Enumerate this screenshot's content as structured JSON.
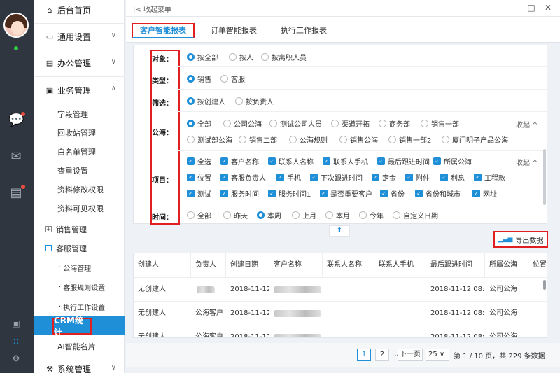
{
  "nav": {
    "home": "后台首页",
    "general": "通用设置",
    "office": "办公管理",
    "business": "业务管理",
    "business_items": [
      "字段管理",
      "回收站管理",
      "白名单管理",
      "查重设置",
      "资料修改权限",
      "资料可见权限"
    ],
    "sales": "销售管理",
    "service": "客服管理",
    "service_items": [
      "公海管理",
      "客服规则设置",
      "执行工作设置"
    ],
    "crm": "CRM统计",
    "ai": "AI智能名片",
    "system": "系统管理"
  },
  "window": {
    "collapse_label": "收起菜单"
  },
  "tabs": [
    "客户智能报表",
    "订单智能报表",
    "执行工作报表"
  ],
  "filters": {
    "object_label": "对象：",
    "object_options": [
      "按全部",
      "按人",
      "按离职人员"
    ],
    "type_label": "类型：",
    "type_options": [
      "销售",
      "客服"
    ],
    "filter_label": "筛选：",
    "filter_options": [
      "按创建人",
      "按负责人"
    ],
    "sea_label": "公海：",
    "sea_row1": [
      "全部",
      "公司公海",
      "测试公司人员",
      "渠道开拓",
      "商务部",
      "销售一部"
    ],
    "sea_row2": [
      "测试部公海",
      "销售二部",
      "公海规则",
      "销售公海",
      "销售一部2",
      "厦门明子产品公海"
    ],
    "collapse": "收起 ^",
    "project_label": "项目：",
    "project_row1": [
      "全选",
      "客户名称",
      "联系人名称",
      "联系人手机",
      "最后跟进时间",
      "所属公海"
    ],
    "project_row2": [
      "位置",
      "客服负责人",
      "手机",
      "下次跟进时间",
      "定金",
      "附件",
      "利息",
      "工程款"
    ],
    "project_row3": [
      "测试",
      "服务时间",
      "服务时间1",
      "是否重要客户",
      "省份",
      "省份和城市",
      "网址"
    ],
    "time_label": "时间：",
    "time_options": [
      "全部",
      "昨天",
      "本周",
      "上月",
      "本月",
      "今年",
      "自定义日期"
    ]
  },
  "export_label": "导出数据",
  "table": {
    "headers": [
      "创建人",
      "负责人",
      "创建日期",
      "客户名称",
      "联系人名称",
      "联系人手机",
      "最后跟进时间",
      "所属公海",
      "位置"
    ],
    "rows": [
      {
        "creator": "无创建人",
        "owner": "",
        "date": "2018-11-12",
        "last": "2018-11-12 08:4!",
        "sea": "公司公海"
      },
      {
        "creator": "无创建人",
        "owner": "公海客户",
        "date": "2018-11-12",
        "last": "2018-11-12 08:5:",
        "sea": "公司公海"
      },
      {
        "creator": "无创建人",
        "owner": "公海客户",
        "date": "2018-11-12",
        "last": "2018-11-12 08:5:",
        "sea": "公司公海"
      }
    ]
  },
  "pager": {
    "pages": [
      "1",
      "2"
    ],
    "ellipsis": "...",
    "next": "下一页",
    "size": "25",
    "info": "第 1 / 10 页，共 229 条数据"
  }
}
